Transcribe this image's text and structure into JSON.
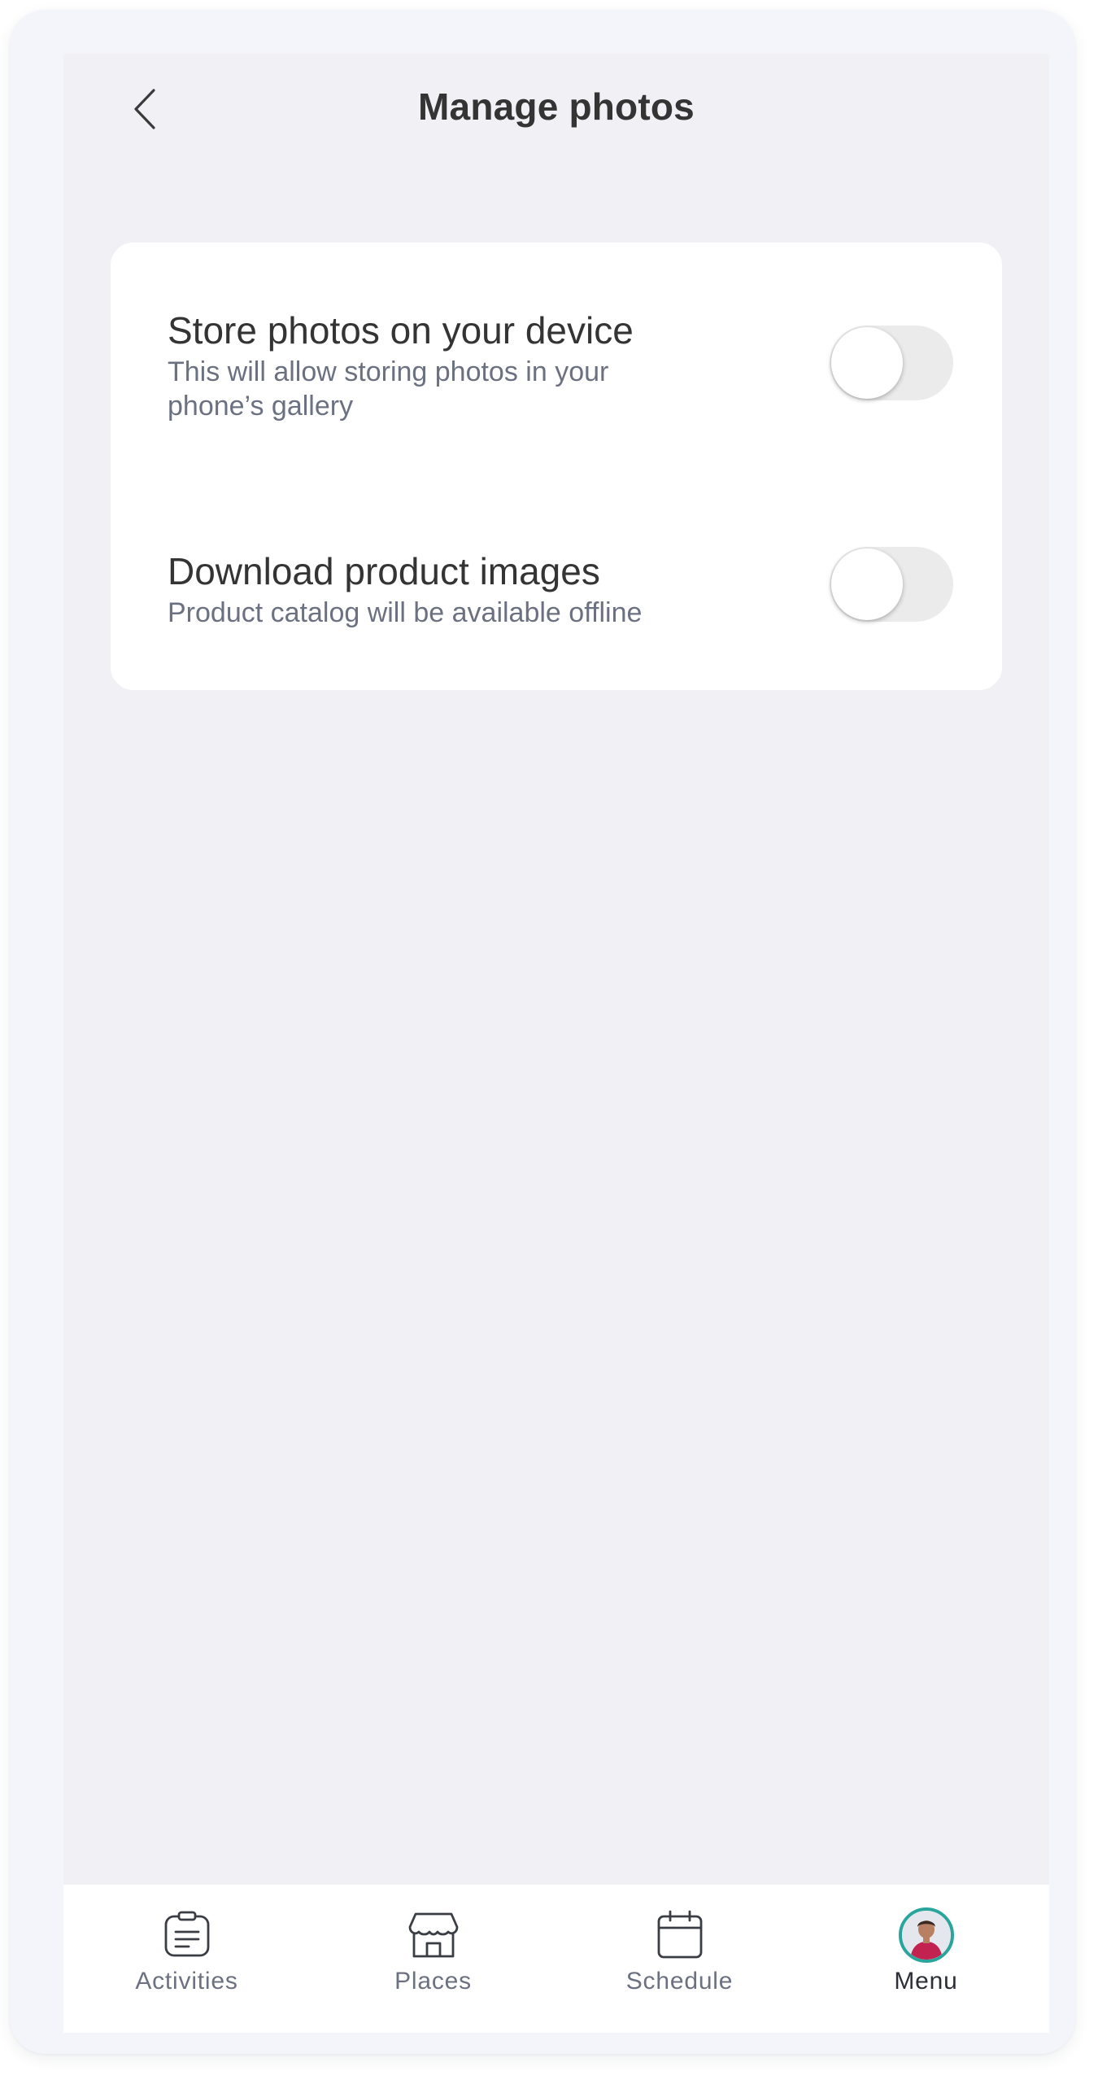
{
  "header": {
    "back_icon": "chevron-left-icon",
    "title": "Manage photos"
  },
  "settings": [
    {
      "title": "Store photos on your device",
      "description_line1": "This will allow storing photos in your",
      "description_line2": "phone’s gallery",
      "enabled": false
    },
    {
      "title": "Download product images",
      "description_line1": "Product catalog will be available offline",
      "enabled": false
    }
  ],
  "nav": {
    "items": [
      {
        "label": "Activities",
        "icon": "clipboard-icon",
        "active": false
      },
      {
        "label": "Places",
        "icon": "store-icon",
        "active": false
      },
      {
        "label": "Schedule",
        "icon": "calendar-icon",
        "active": false
      },
      {
        "label": "Menu",
        "icon": "avatar",
        "active": true
      }
    ]
  },
  "colors": {
    "screen_bg": "#f0f0f5",
    "card_bg": "#ffffff",
    "toggle_off": "#ebebeb",
    "avatar_ring": "#2aa59c",
    "text_primary": "#343434",
    "text_secondary": "#6b7180"
  }
}
